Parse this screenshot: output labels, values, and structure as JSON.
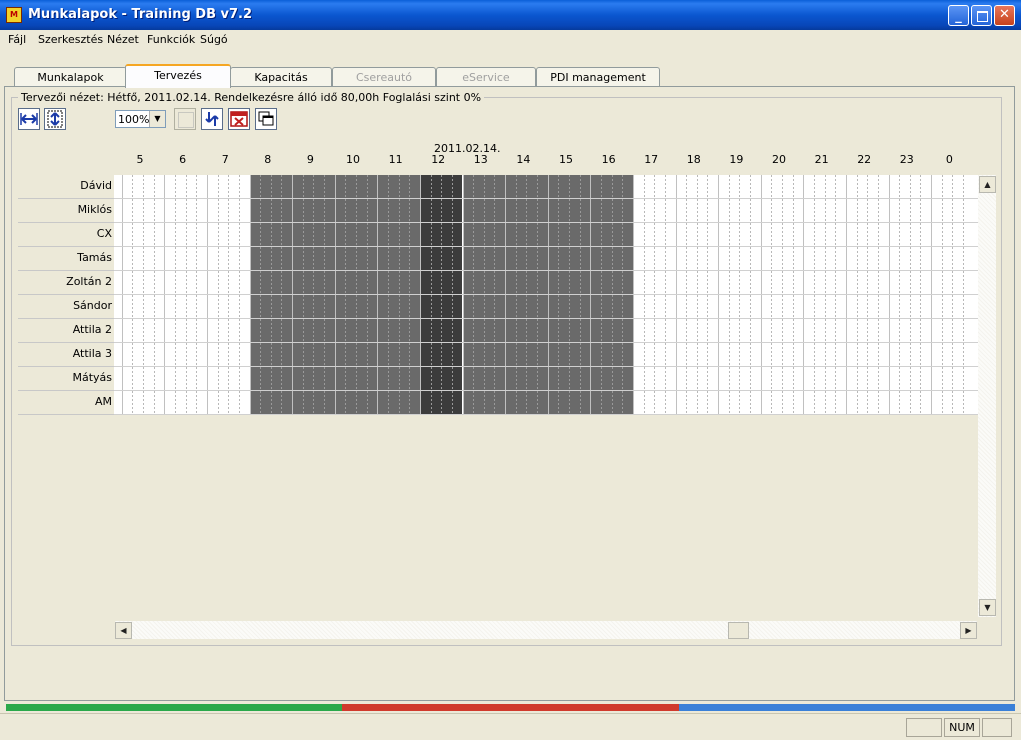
{
  "window": {
    "title": "Munkalapok - Training DB v7.2",
    "icon_name": "app-icon"
  },
  "menu": [
    "Fájl",
    "Szerkesztés",
    "Nézet",
    "Funkciók",
    "Súgó"
  ],
  "tabs": [
    {
      "label": "Munkalapok",
      "active": false,
      "disabled": false
    },
    {
      "label": "Tervezés",
      "active": true,
      "disabled": false
    },
    {
      "label": "Kapacitás",
      "active": false,
      "disabled": false
    },
    {
      "label": "Csereautó",
      "active": false,
      "disabled": true
    },
    {
      "label": "eService",
      "active": false,
      "disabled": true
    },
    {
      "label": "PDI management",
      "active": false,
      "disabled": false
    }
  ],
  "planner": {
    "caption": "Tervezői nézet: Hétfő, 2011.02.14. Rendelkezésre álló idő 80,00h Foglalási szint 0%",
    "zoom": "100%",
    "date": "2011.02.14.",
    "hours": [
      "5",
      "6",
      "7",
      "8",
      "9",
      "10",
      "11",
      "12",
      "13",
      "14",
      "15",
      "16",
      "17",
      "18",
      "19",
      "20",
      "21",
      "22",
      "23",
      "0"
    ],
    "resources": [
      "Dávid",
      "Miklós",
      "CX",
      "Tamás",
      "Zoltán 2",
      "Sándor",
      "Attila 2",
      "Attila 3",
      "Mátyás",
      "AM"
    ],
    "working_hours": [
      "8",
      "9",
      "10",
      "11",
      "12",
      "13",
      "14",
      "15",
      "16"
    ],
    "break_hour": "12",
    "colors": {
      "working": "#6a6a6a",
      "break": "#3c3c3c",
      "free": "#ffffff"
    }
  },
  "toolbar_icons": [
    "fit-width-icon",
    "fit-height-icon",
    "blank-icon",
    "refresh-arrows-icon",
    "calendar-delete-icon",
    "copy-windows-icon"
  ],
  "statusbar": {
    "num": "NUM"
  },
  "colorbar": [
    "#2aa84a",
    "#d03a2c",
    "#3a80d8"
  ]
}
